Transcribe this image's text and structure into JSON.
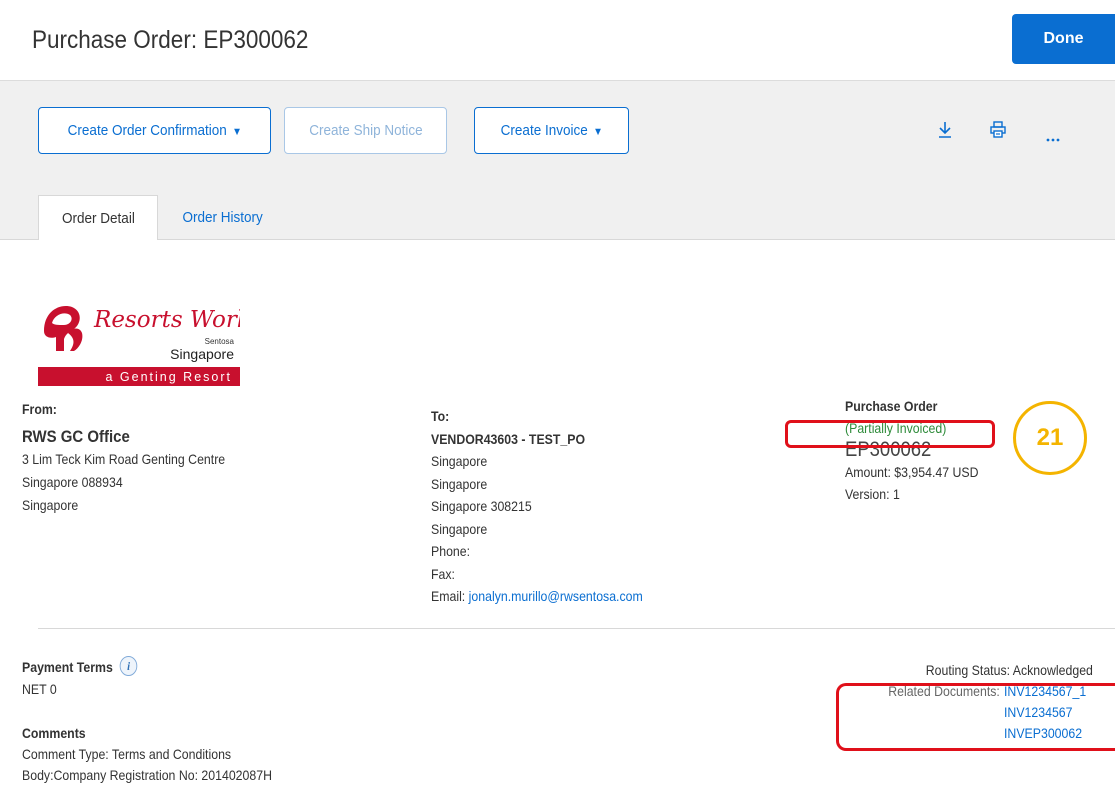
{
  "header": {
    "title": "Purchase Order: EP300062",
    "done_label": "Done"
  },
  "toolbar": {
    "create_order_confirmation": "Create Order Confirmation",
    "create_ship_notice": "Create Ship Notice",
    "create_invoice": "Create Invoice",
    "caret": "▼",
    "download_icon": "download-icon",
    "print_icon": "print-icon",
    "more_icon": "more-icon"
  },
  "tabs": [
    {
      "label": "Order Detail",
      "active": true
    },
    {
      "label": "Order History",
      "active": false
    }
  ],
  "logo": {
    "script_text": "Resorts World",
    "sentosa": "Sentosa",
    "singapore": "Singapore",
    "tagline": "a Genting Resort"
  },
  "from": {
    "label": "From:",
    "name": "RWS GC Office",
    "lines": [
      "3 Lim Teck Kim Road Genting Centre",
      "Singapore 088934",
      "Singapore"
    ]
  },
  "to": {
    "label": "To:",
    "name": "VENDOR43603 - TEST_PO",
    "lines": [
      "Singapore",
      "Singapore",
      "Singapore 308215",
      "Singapore",
      "Phone:",
      "Fax:"
    ],
    "email_label": "Email:",
    "email": "jonalyn.murillo@rwsentosa.com"
  },
  "purchase_order": {
    "label": "Purchase Order",
    "status": "(Partially Invoiced)",
    "number": "EP300062",
    "amount": "Amount: $3,954.47 USD",
    "version": "Version: 1"
  },
  "annotation": {
    "badge": "21"
  },
  "payment": {
    "label": "Payment Terms",
    "value": "NET 0"
  },
  "comments": {
    "label": "Comments",
    "type": "Comment Type: Terms and Conditions",
    "body": "Body:Company Registration No: 201402087H"
  },
  "routing": {
    "status": "Routing Status: Acknowledged",
    "related_label": "Related Documents:",
    "documents": [
      "INV1234567_1",
      "INV1234567",
      "INVEP300062"
    ]
  },
  "colors": {
    "accent": "#0a6ed1",
    "status_green": "#2e8b3a",
    "highlight_red": "#e0101a",
    "badge_yellow": "#f4b400",
    "brand_red": "#c8102e"
  }
}
